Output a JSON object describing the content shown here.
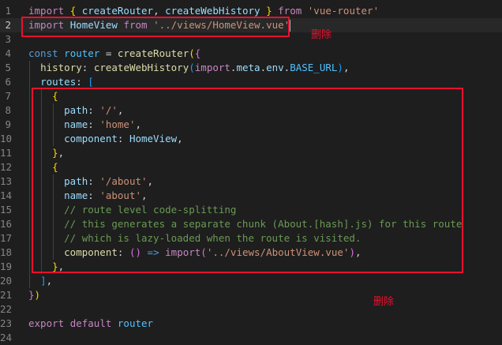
{
  "lines": [
    {
      "n": "1",
      "tokens": [
        [
          "kw",
          "import"
        ],
        [
          "txt",
          " "
        ],
        [
          "br1",
          "{"
        ],
        [
          "txt",
          " "
        ],
        [
          "var",
          "createRouter"
        ],
        [
          "txt",
          ", "
        ],
        [
          "var",
          "createWebHistory"
        ],
        [
          "txt",
          " "
        ],
        [
          "br1",
          "}"
        ],
        [
          "txt",
          " "
        ],
        [
          "kw",
          "from"
        ],
        [
          "txt",
          " "
        ],
        [
          "str",
          "'vue-router'"
        ]
      ]
    },
    {
      "n": "2",
      "tokens": [
        [
          "kw",
          "import"
        ],
        [
          "txt",
          " "
        ],
        [
          "var",
          "HomeView"
        ],
        [
          "txt",
          " "
        ],
        [
          "kw",
          "from"
        ],
        [
          "txt",
          " "
        ],
        [
          "str",
          "'../views/HomeView.vue'"
        ]
      ]
    },
    {
      "n": "3",
      "tokens": []
    },
    {
      "n": "4",
      "tokens": [
        [
          "kw2",
          "const"
        ],
        [
          "txt",
          " "
        ],
        [
          "cst",
          "router"
        ],
        [
          "txt",
          " = "
        ],
        [
          "fn",
          "createRouter"
        ],
        [
          "br1",
          "("
        ],
        [
          "br2",
          "{"
        ]
      ]
    },
    {
      "n": "5",
      "tokens": [
        [
          "txt",
          "  "
        ],
        [
          "fn",
          "history"
        ],
        [
          "txt",
          ": "
        ],
        [
          "fn",
          "createWebHistory"
        ],
        [
          "br3",
          "("
        ],
        [
          "kw",
          "import"
        ],
        [
          "txt",
          "."
        ],
        [
          "var",
          "meta"
        ],
        [
          "txt",
          "."
        ],
        [
          "var",
          "env"
        ],
        [
          "txt",
          "."
        ],
        [
          "cst",
          "BASE_URL"
        ],
        [
          "br3",
          ")"
        ],
        [
          "txt",
          ","
        ]
      ]
    },
    {
      "n": "6",
      "tokens": [
        [
          "txt",
          "  "
        ],
        [
          "var",
          "routes"
        ],
        [
          "txt",
          ": "
        ],
        [
          "br3",
          "["
        ]
      ]
    },
    {
      "n": "7",
      "tokens": [
        [
          "txt",
          "    "
        ],
        [
          "br1",
          "{"
        ]
      ]
    },
    {
      "n": "8",
      "tokens": [
        [
          "txt",
          "      "
        ],
        [
          "var",
          "path"
        ],
        [
          "txt",
          ": "
        ],
        [
          "str",
          "'/'"
        ],
        [
          "txt",
          ","
        ]
      ]
    },
    {
      "n": "9",
      "tokens": [
        [
          "txt",
          "      "
        ],
        [
          "var",
          "name"
        ],
        [
          "txt",
          ": "
        ],
        [
          "str",
          "'home'"
        ],
        [
          "txt",
          ","
        ]
      ]
    },
    {
      "n": "10",
      "tokens": [
        [
          "txt",
          "      "
        ],
        [
          "var",
          "component"
        ],
        [
          "txt",
          ": "
        ],
        [
          "var",
          "HomeView"
        ],
        [
          "txt",
          ","
        ]
      ]
    },
    {
      "n": "11",
      "tokens": [
        [
          "txt",
          "    "
        ],
        [
          "br1",
          "}"
        ],
        [
          "txt",
          ","
        ]
      ]
    },
    {
      "n": "12",
      "tokens": [
        [
          "txt",
          "    "
        ],
        [
          "br1",
          "{"
        ]
      ]
    },
    {
      "n": "13",
      "tokens": [
        [
          "txt",
          "      "
        ],
        [
          "var",
          "path"
        ],
        [
          "txt",
          ": "
        ],
        [
          "str",
          "'/about'"
        ],
        [
          "txt",
          ","
        ]
      ]
    },
    {
      "n": "14",
      "tokens": [
        [
          "txt",
          "      "
        ],
        [
          "var",
          "name"
        ],
        [
          "txt",
          ": "
        ],
        [
          "str",
          "'about'"
        ],
        [
          "txt",
          ","
        ]
      ]
    },
    {
      "n": "15",
      "tokens": [
        [
          "txt",
          "      "
        ],
        [
          "cmt",
          "// route level code-splitting"
        ]
      ]
    },
    {
      "n": "16",
      "tokens": [
        [
          "txt",
          "      "
        ],
        [
          "cmt",
          "// this generates a separate chunk (About.[hash].js) for this route"
        ]
      ]
    },
    {
      "n": "17",
      "tokens": [
        [
          "txt",
          "      "
        ],
        [
          "cmt",
          "// which is lazy-loaded when the route is visited."
        ]
      ]
    },
    {
      "n": "18",
      "tokens": [
        [
          "txt",
          "      "
        ],
        [
          "fn",
          "component"
        ],
        [
          "txt",
          ": "
        ],
        [
          "br2",
          "()"
        ],
        [
          "txt",
          " "
        ],
        [
          "kw2",
          "=>"
        ],
        [
          "txt",
          " "
        ],
        [
          "kw",
          "import"
        ],
        [
          "br2",
          "("
        ],
        [
          "str",
          "'../views/AboutView.vue'"
        ],
        [
          "br2",
          ")"
        ],
        [
          "txt",
          ","
        ]
      ]
    },
    {
      "n": "19",
      "tokens": [
        [
          "txt",
          "    "
        ],
        [
          "br1",
          "}"
        ],
        [
          "txt",
          ","
        ]
      ]
    },
    {
      "n": "20",
      "tokens": [
        [
          "txt",
          "  "
        ],
        [
          "br3",
          "]"
        ],
        [
          "txt",
          ","
        ]
      ]
    },
    {
      "n": "21",
      "tokens": [
        [
          "br2",
          "}"
        ],
        [
          "br1",
          ")"
        ]
      ]
    },
    {
      "n": "22",
      "tokens": []
    },
    {
      "n": "23",
      "tokens": [
        [
          "kw",
          "export"
        ],
        [
          "txt",
          " "
        ],
        [
          "kw",
          "default"
        ],
        [
          "txt",
          " "
        ],
        [
          "cst",
          "router"
        ]
      ]
    },
    {
      "n": "24",
      "tokens": []
    }
  ],
  "active_line": "2",
  "annotations": {
    "delete_label_1": "删除",
    "delete_label_2": "删除"
  },
  "colors": {
    "background": "#1e1e1e",
    "annotation_red": "#e8102e"
  }
}
